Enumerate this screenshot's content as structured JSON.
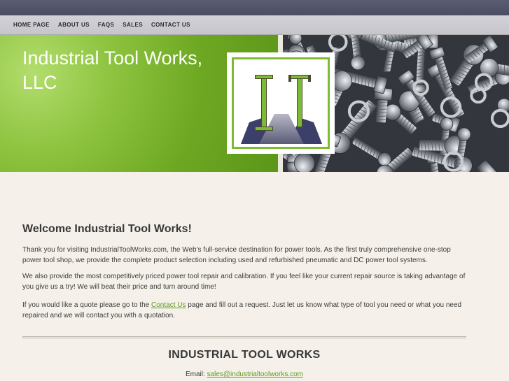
{
  "nav": {
    "items": [
      {
        "label": "HOME PAGE"
      },
      {
        "label": "ABOUT US"
      },
      {
        "label": "FAQS"
      },
      {
        "label": "SALES"
      },
      {
        "label": "CONTACT US"
      }
    ]
  },
  "hero": {
    "title_line1": "Industrial Tool Works,",
    "title_line2": "LLC",
    "logo_letters": [
      "I",
      "T"
    ],
    "accent_color": "#7dbc32"
  },
  "main": {
    "heading": "Welcome Industrial Tool Works!",
    "p1": "Thank you for visiting IndustrialToolWorks.com, the Web's full-service destination for power tools. As the first truly comprehensive one-stop power tool shop, we provide the complete product selection including used and refurbished pneumatic and DC power tool systems.",
    "p2": "We also provide the most competitively priced power tool repair and calibration.  If you feel like your current repair source is taking advantage of you give us a try!  We will beat their price and turn around time!",
    "p3_before": "If you would like a quote please go to the ",
    "p3_link": "Contact Us",
    "p3_after": " page and fill out a request.  Just let us know what type of tool you need or what you need repaired and we will contact you with a quotation."
  },
  "footer": {
    "title": "INDUSTRIAL TOOL WORKS",
    "email_label": "Email: ",
    "email": "sales@industrialtoolworks.com"
  }
}
